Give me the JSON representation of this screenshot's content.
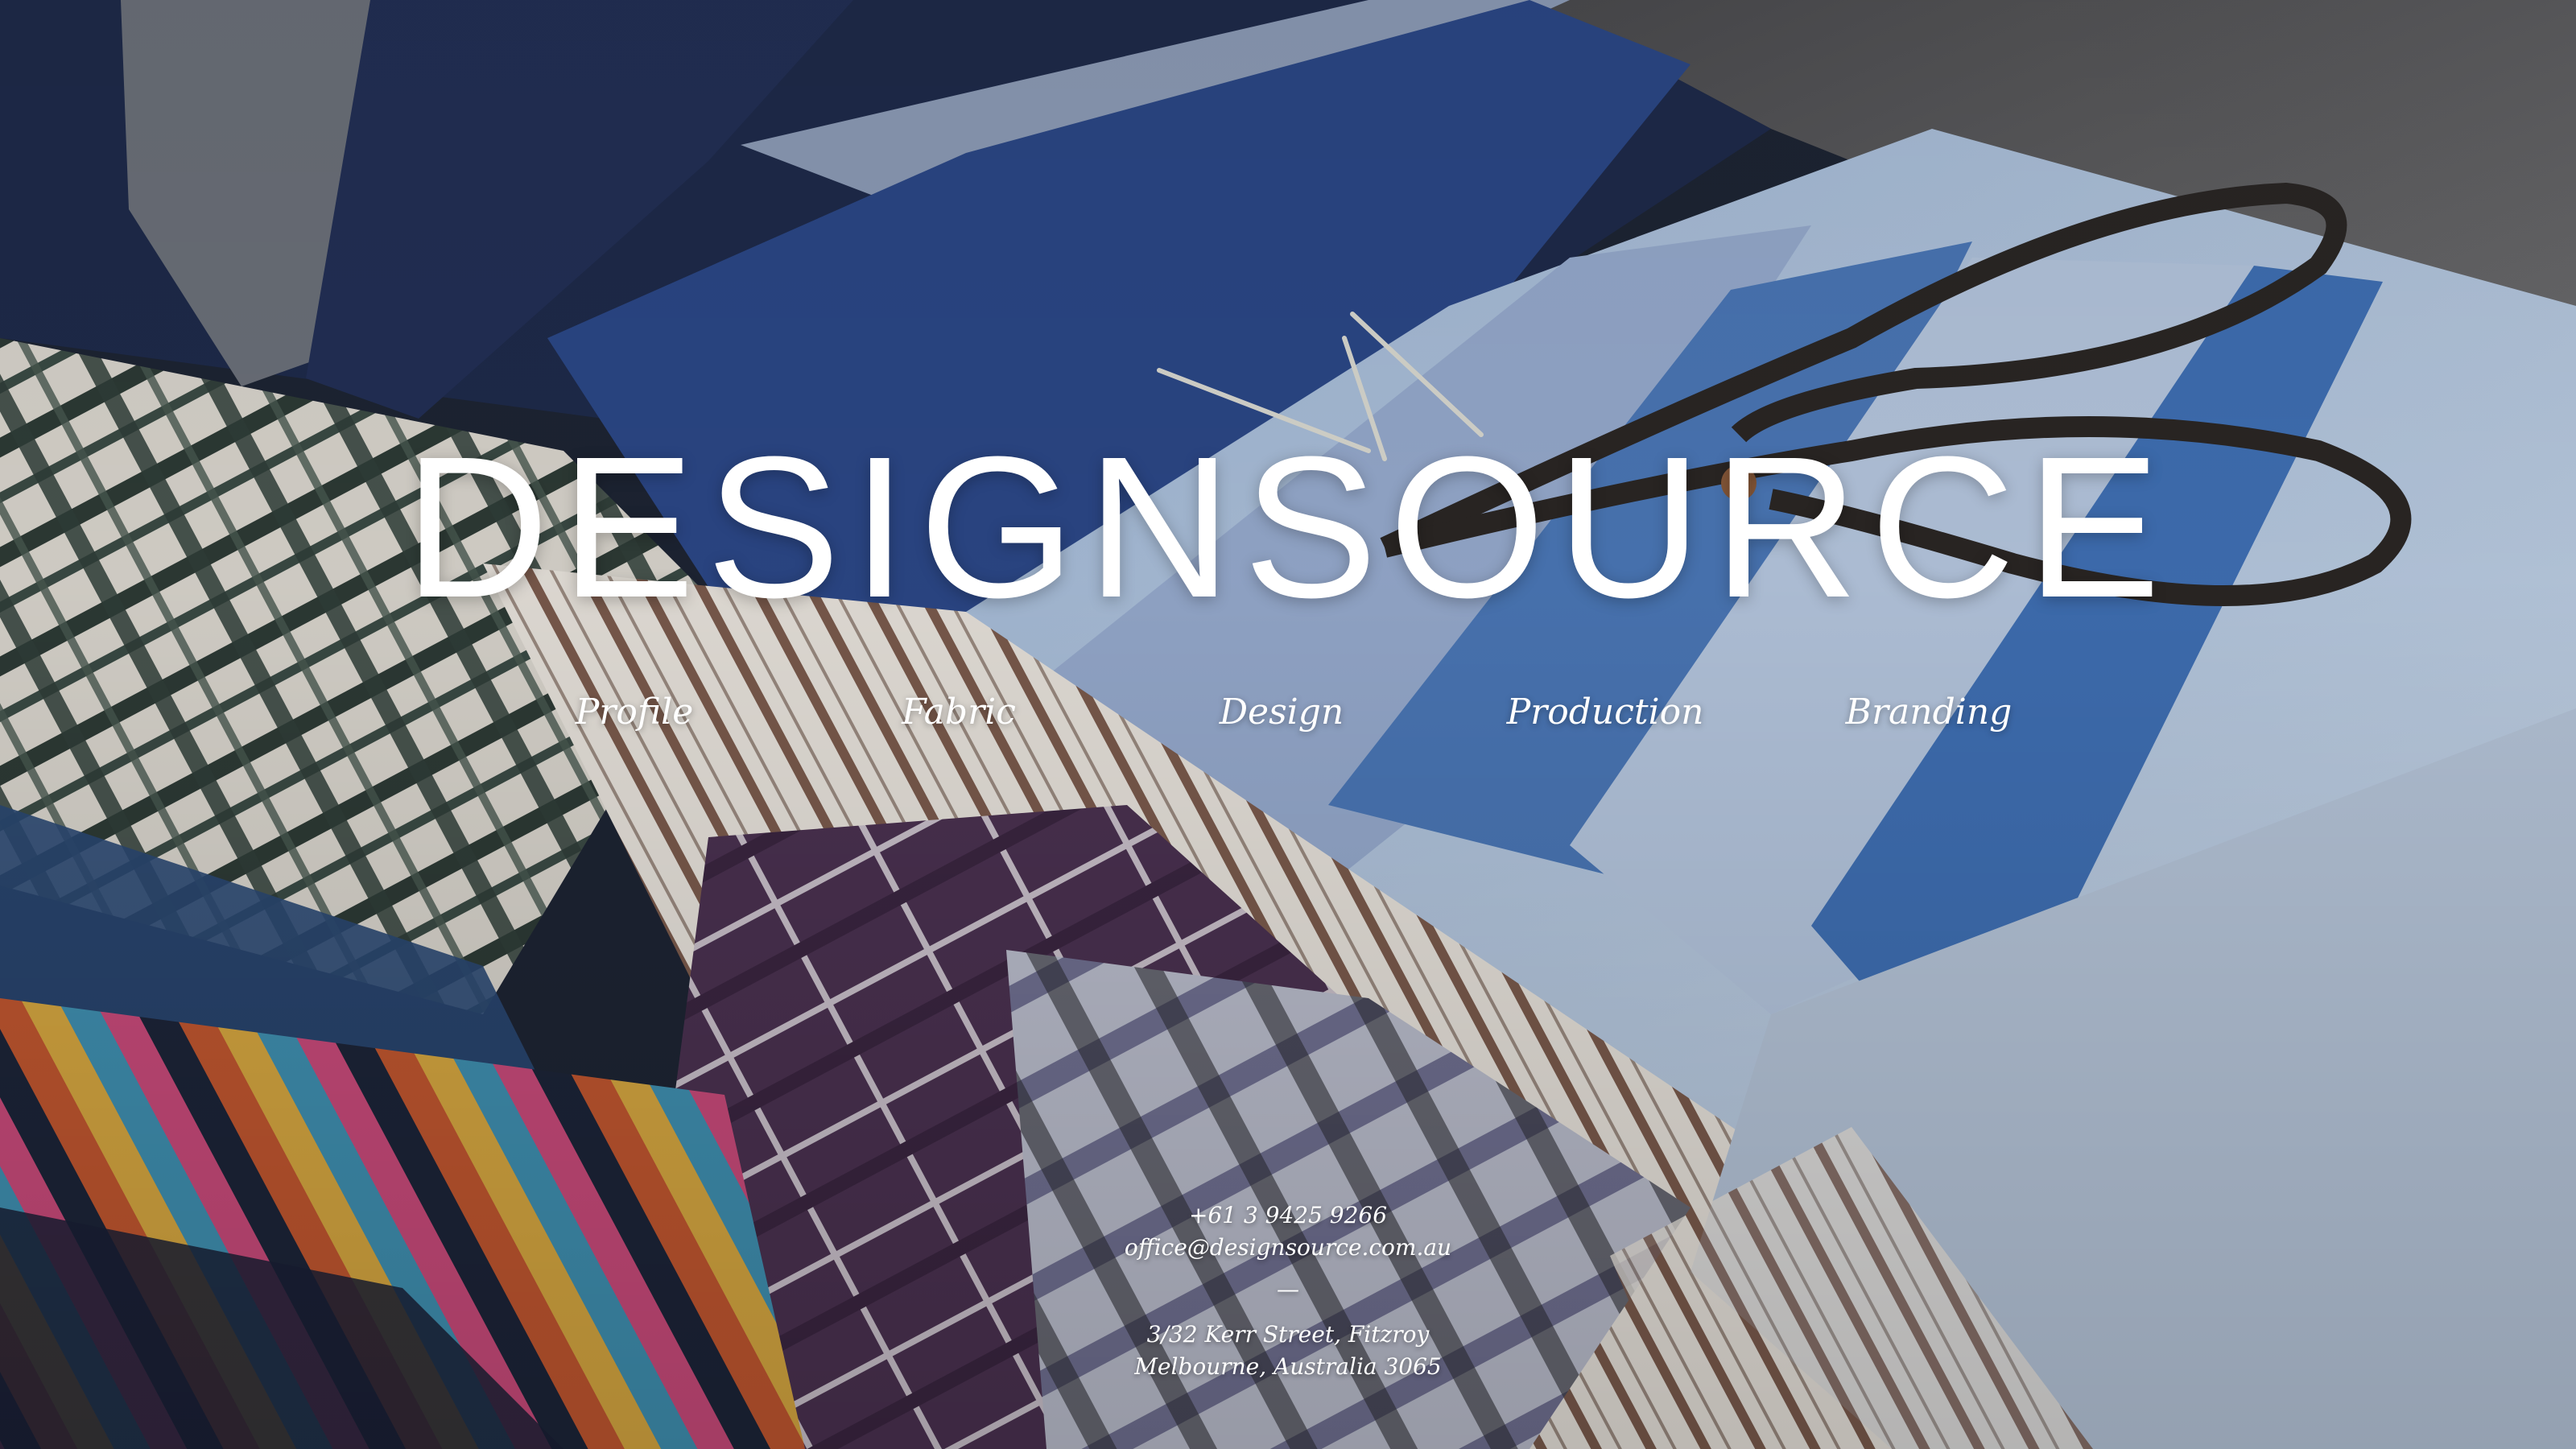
{
  "site": {
    "brand": "DESIGNSOURCE"
  },
  "nav": {
    "items": [
      {
        "label": "Profile"
      },
      {
        "label": "Fabric"
      },
      {
        "label": "Design"
      },
      {
        "label": "Production"
      },
      {
        "label": "Branding"
      }
    ]
  },
  "contact": {
    "phone": "+61 3 9425 9266",
    "email": "office@designsource.com.au",
    "separator": "—",
    "address_line1": "3/32 Kerr Street, Fitzroy",
    "address_line2": "Melbourne, Australia 3065"
  },
  "background": {
    "subject": "stacked fabric swatch books with scissors and pins",
    "colors": {
      "navy": "#24386a",
      "denim": "#3f6fb3",
      "light_blue": "#a8bfdc",
      "grey": "#5e5e60",
      "plaid_purple": "#4a3150",
      "cream": "#d9d3c8"
    }
  }
}
